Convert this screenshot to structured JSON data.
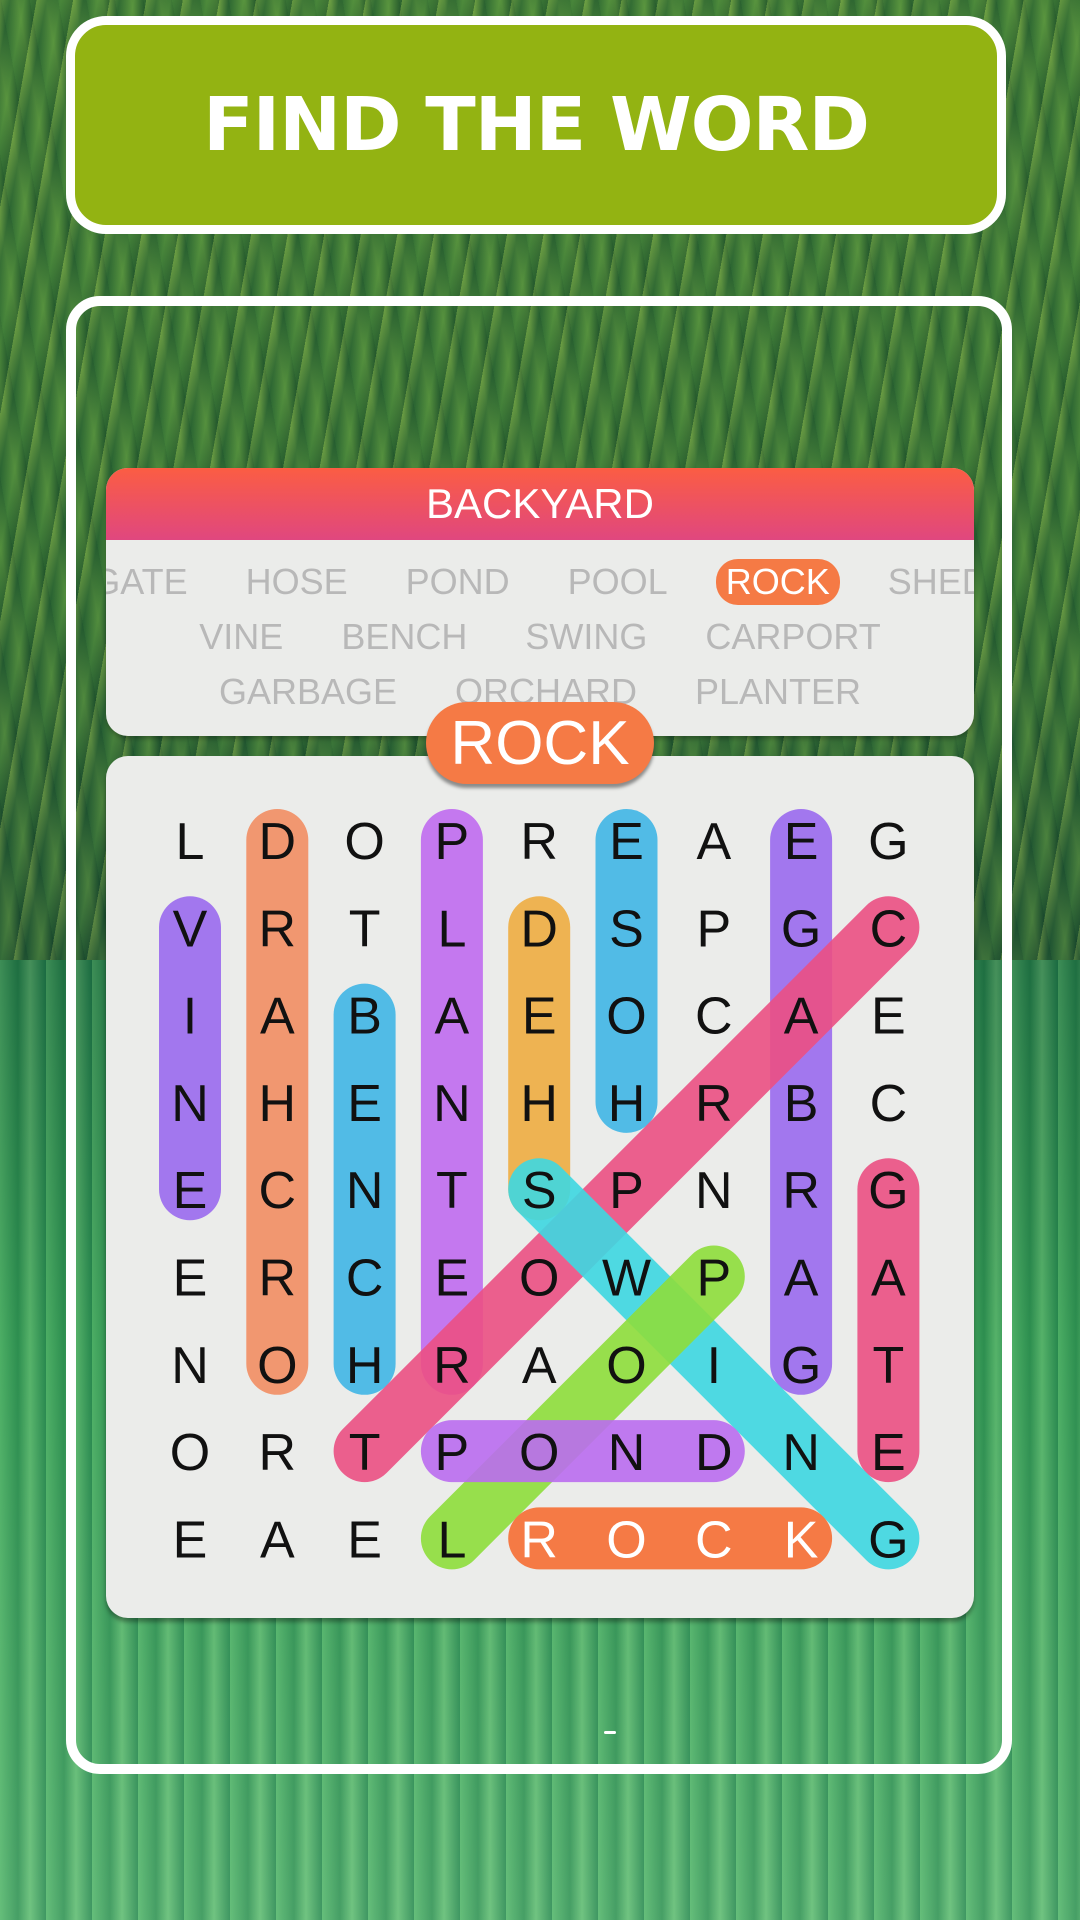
{
  "header": {
    "title": "FIND THE WORD"
  },
  "category": {
    "title": "BACKYARD",
    "word_rows": [
      [
        {
          "text": "GATE",
          "found": true
        },
        {
          "text": "HOSE",
          "found": true
        },
        {
          "text": "POND",
          "found": true
        },
        {
          "text": "POOL",
          "found": true
        },
        {
          "text": "ROCK",
          "found": true,
          "active": true
        },
        {
          "text": "SHED",
          "found": true
        }
      ],
      [
        {
          "text": "VINE",
          "found": true
        },
        {
          "text": "BENCH",
          "found": true
        },
        {
          "text": "SWING",
          "found": true
        },
        {
          "text": "CARPORT",
          "found": true
        }
      ],
      [
        {
          "text": "GARBAGE",
          "found": true
        },
        {
          "text": "ORCHARD",
          "found": true
        },
        {
          "text": "PLANTER",
          "found": true
        }
      ]
    ]
  },
  "current_word": "ROCK",
  "grid": {
    "rows": [
      [
        "L",
        "D",
        "O",
        "P",
        "R",
        "E",
        "A",
        "E",
        "G"
      ],
      [
        "V",
        "R",
        "T",
        "L",
        "D",
        "S",
        "P",
        "G",
        "C"
      ],
      [
        "I",
        "A",
        "B",
        "A",
        "E",
        "O",
        "C",
        "A",
        "E"
      ],
      [
        "N",
        "H",
        "E",
        "N",
        "H",
        "H",
        "R",
        "B",
        "C"
      ],
      [
        "E",
        "C",
        "N",
        "T",
        "S",
        "P",
        "N",
        "R",
        "G"
      ],
      [
        "E",
        "R",
        "C",
        "E",
        "O",
        "W",
        "P",
        "A",
        "A"
      ],
      [
        "N",
        "O",
        "H",
        "R",
        "A",
        "O",
        "I",
        "G",
        "T"
      ],
      [
        "O",
        "R",
        "T",
        "P",
        "O",
        "N",
        "D",
        "N",
        "E"
      ],
      [
        "E",
        "A",
        "E",
        "L",
        "R",
        "O",
        "C",
        "K",
        "G"
      ]
    ],
    "highlights": [
      {
        "word": "VINE",
        "from": [
          1,
          0
        ],
        "to": [
          4,
          0
        ],
        "color": "#9b6bef"
      },
      {
        "word": "ORCHARD",
        "from": [
          6,
          1
        ],
        "to": [
          0,
          1
        ],
        "color": "#f28e63"
      },
      {
        "word": "BENCH",
        "from": [
          2,
          2
        ],
        "to": [
          6,
          2
        ],
        "color": "#41b6e6"
      },
      {
        "word": "PLANTER",
        "from": [
          0,
          3
        ],
        "to": [
          6,
          3
        ],
        "color": "#c06cf0"
      },
      {
        "word": "SHED",
        "from": [
          4,
          4
        ],
        "to": [
          1,
          4
        ],
        "color": "#efad42"
      },
      {
        "word": "HOSE",
        "from": [
          3,
          5
        ],
        "to": [
          0,
          5
        ],
        "color": "#41b6e6"
      },
      {
        "word": "GARBAGE",
        "from": [
          6,
          7
        ],
        "to": [
          0,
          7
        ],
        "color": "#9b6bef"
      },
      {
        "word": "GATE",
        "from": [
          4,
          8
        ],
        "to": [
          7,
          8
        ],
        "color": "#ec5084"
      },
      {
        "word": "CARPORT",
        "from": [
          1,
          8
        ],
        "to": [
          7,
          2
        ],
        "color": "#ec5084"
      },
      {
        "word": "SWING",
        "from": [
          4,
          4
        ],
        "to": [
          8,
          8
        ],
        "color": "#3ed8e2"
      },
      {
        "word": "POOL",
        "from": [
          5,
          6
        ],
        "to": [
          8,
          3
        ],
        "color": "#8ede3c"
      },
      {
        "word": "POND",
        "from": [
          7,
          3
        ],
        "to": [
          7,
          6
        ],
        "color": "#bb6df0"
      },
      {
        "word": "ROCK",
        "from": [
          8,
          4
        ],
        "to": [
          8,
          7
        ],
        "color": "#f57a45",
        "active": true
      }
    ]
  },
  "colors": {
    "banner": "#93b312",
    "category_header_top": "#fb5d43",
    "category_header_bottom": "#e0477f",
    "active_word": "#f57a45",
    "muted_word": "#b8b8b8"
  }
}
